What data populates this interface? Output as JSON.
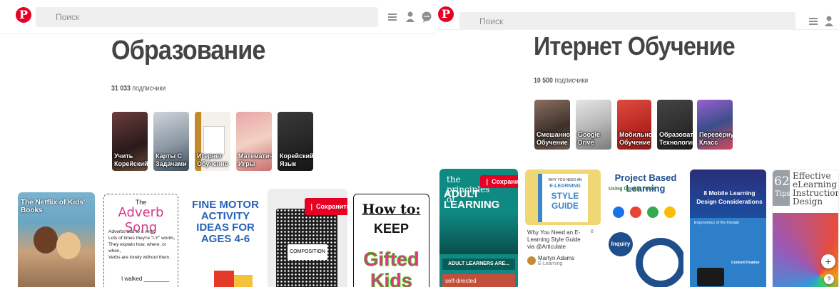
{
  "left": {
    "search": {
      "placeholder": "Поиск"
    },
    "board": {
      "title": "Образование",
      "followers_count": "31 033",
      "followers_label": "подписчики"
    },
    "sections": [
      {
        "label": "Учить Корейский",
        "color": "#4a2a2a"
      },
      {
        "label": "Карты С Задачами",
        "color": "#44505c"
      },
      {
        "label": "Игернет Обучение",
        "color": "#7b5a1e"
      },
      {
        "label": "Математич... Игры",
        "color": "#d88f8f"
      },
      {
        "label": "Корейский Язык",
        "color": "#2a2a2a"
      }
    ],
    "pins": [
      {
        "title": "The Netflix of Kids' Books"
      },
      {
        "title_top": "The",
        "title_main": "Adverb Song",
        "lines": [
          "Adverbs add to a verb,",
          "Lots of times they're \"l-Y\" words,",
          "They explain how, where, or when,",
          "Verbs are lonely without them."
        ],
        "footer": "I walked ________"
      },
      {
        "title": "FINE MOTOR ACTIVITY IDEAS FOR AGES 4-6"
      },
      {
        "cover_label": "COMPOSITION",
        "save_label": "Сохранить"
      },
      {
        "title_top": "How to:",
        "title_mid": "KEEP",
        "title_bottom": "Gifted Kids"
      }
    ]
  },
  "right": {
    "search": {
      "placeholder": "Поиск"
    },
    "board": {
      "title": "Итернет Обучение",
      "followers_count": "10 500",
      "followers_label": "подписчики"
    },
    "sections": [
      {
        "label": "Смешанное Обучение",
        "color": "#4b3b35"
      },
      {
        "label": "Google Drive",
        "color": "#7a7a7a"
      },
      {
        "label": "Мобильное Обучение",
        "color": "#c0302c"
      },
      {
        "label": "Образоват... Технологии",
        "color": "#2e2e2e"
      },
      {
        "label": "Перевёрнут... Класс",
        "color": "#5a5a5a"
      }
    ],
    "pins": [
      {
        "title_top": "the principles of",
        "title_main": "ADULT LEARNING",
        "footer": "ADULT LEARNERS ARE...",
        "sub": "self-directed",
        "save_label": "Сохранить"
      },
      {
        "book_lines": [
          "WHY YOU NEED AN",
          "E-LEARNING",
          "STYLE",
          "GUIDE"
        ],
        "desc": "Why You Need an E-Learning Style Guide via @Articulate",
        "count": "8",
        "pinner_name": "Martyn Adams",
        "pinner_board": "E-Learning"
      },
      {
        "title": "Project Based Learning",
        "subtitle": "Using Google Tools",
        "bubble": "Inquiry"
      },
      {
        "title": "8 Mobile Learning Design Considerations",
        "subtitle": "Ergonomics of the Design",
        "content_label": "Content Fixation"
      },
      {
        "number": "62",
        "number_sub": "Tips",
        "title": "Effective eLearning Instructional Design"
      }
    ]
  }
}
